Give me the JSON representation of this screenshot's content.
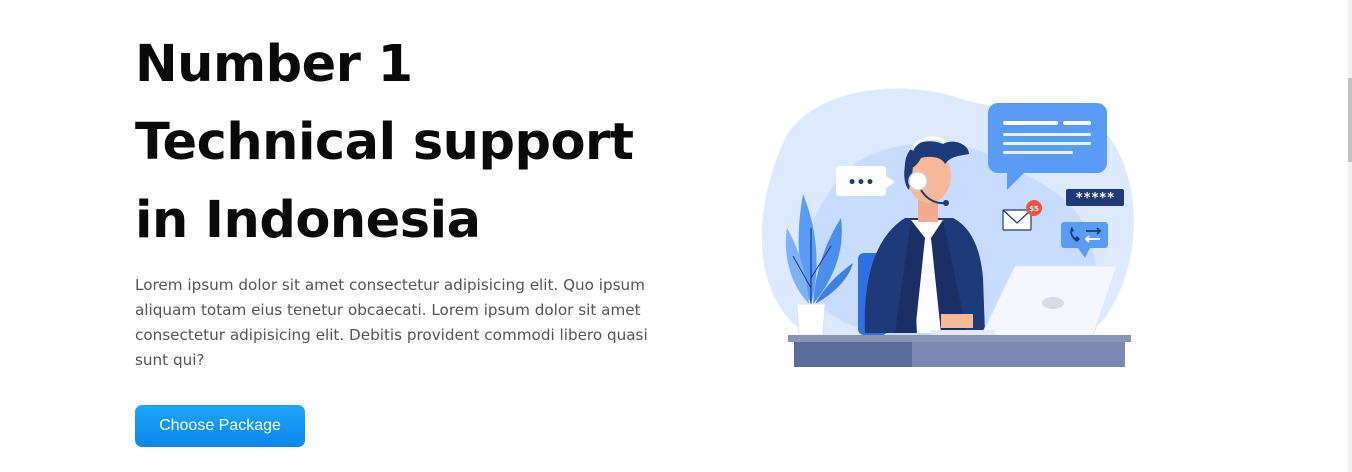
{
  "hero": {
    "title_lines": [
      "Number 1",
      "Technical support",
      "in Indonesia"
    ],
    "description": "Lorem ipsum dolor sit amet consectetur adipisicing elit. Quo ipsum aliquam totam eius tenetur obcaecati. Lorem ipsum dolor sit amet consectetur adipisicing elit. Debitis provident commodi libero quasi sunt qui?",
    "cta_label": "Choose Package"
  },
  "illustration": {
    "subject": "customer-support-agent-illustration",
    "typing_dots": "•••",
    "password_mask": "*****",
    "price_badge": "$5"
  },
  "colors": {
    "title": "#0a0a0a",
    "text": "#555555",
    "cta_gradient_top": "#1fa6f8",
    "cta_gradient_bottom": "#0a86f0",
    "illustration_blob": "#d6e6ff",
    "illustration_accent": "#5a9cf5",
    "illustration_navy": "#1f3a78"
  }
}
